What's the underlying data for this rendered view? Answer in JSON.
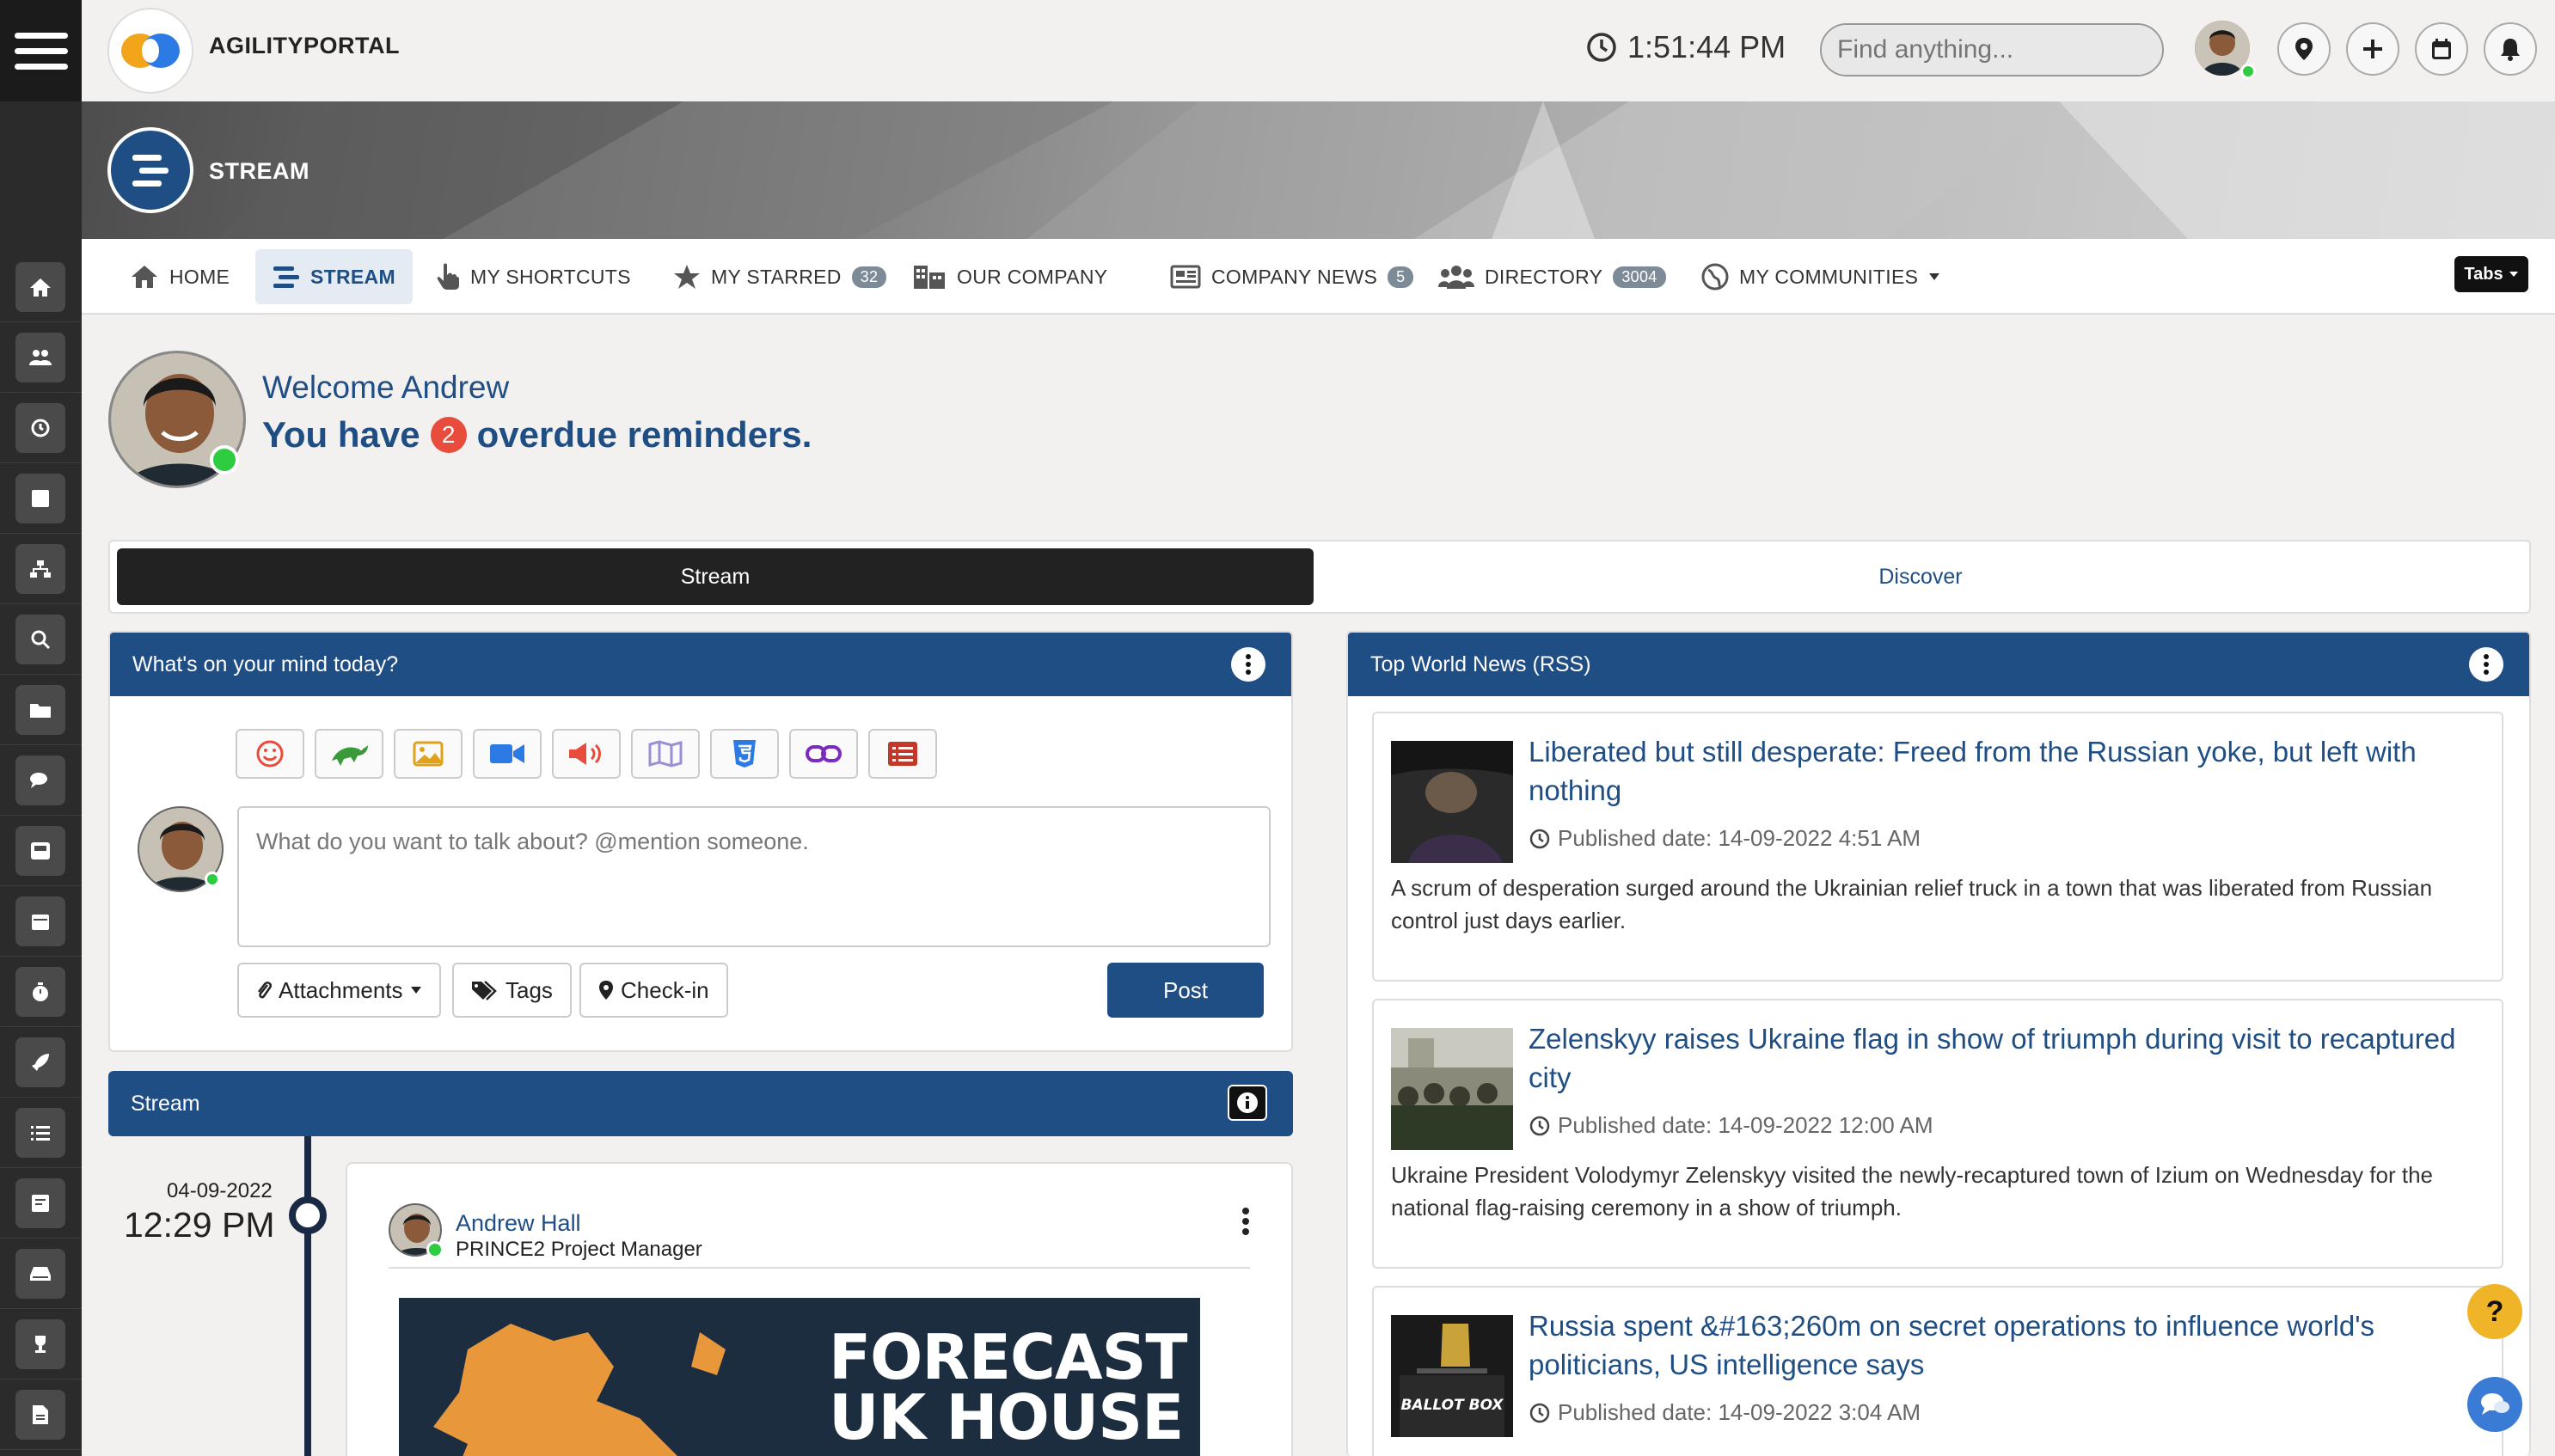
{
  "app": {
    "brand": "AGILITYPORTAL",
    "time": "1:51:44 PM"
  },
  "search": {
    "placeholder": "Find anything..."
  },
  "banner": {
    "title": "STREAM"
  },
  "nav": {
    "tabs": [
      {
        "label": "HOME"
      },
      {
        "label": "STREAM"
      },
      {
        "label": "MY SHORTCUTS"
      },
      {
        "label": "MY STARRED",
        "badge": "32"
      },
      {
        "label": "OUR COMPANY"
      },
      {
        "label": "COMPANY NEWS",
        "badge": "5"
      },
      {
        "label": "DIRECTORY",
        "badge": "3004"
      },
      {
        "label": "MY COMMUNITIES"
      }
    ],
    "tabs_button": "Tabs"
  },
  "welcome": {
    "greeting": "Welcome Andrew",
    "prefix": "You have",
    "count": "2",
    "suffix": "overdue reminders."
  },
  "segment": {
    "stream": "Stream",
    "discover": "Discover"
  },
  "composer": {
    "title": "What's on your mind today?",
    "placeholder": "What do you want to talk about? @mention someone.",
    "attachments": "Attachments",
    "tags": "Tags",
    "checkin": "Check-in",
    "post": "Post"
  },
  "stream": {
    "title": "Stream",
    "date": "04-09-2022",
    "time": "12:29 PM",
    "author": "Andrew Hall",
    "role": "PRINCE2 Project Manager",
    "image_headline": [
      "FORECAST",
      "UK HOUSE"
    ]
  },
  "news": {
    "title": "Top World News (RSS)",
    "items": [
      {
        "title": "Liberated but still desperate: Freed from the Russian yoke, but left with nothing",
        "date": "Published date: 14-09-2022 4:51 AM",
        "summary": "A scrum of desperation surged around the Ukrainian relief truck in a town that was liberated from Russian control just days earlier."
      },
      {
        "title": "Zelenskyy raises Ukraine flag in show of triumph during visit to recaptured city",
        "date": "Published date: 14-09-2022 12:00 AM",
        "summary": "Ukraine President Volodymyr Zelenskyy visited the newly-recaptured town of Izium on Wednesday for the national flag-raising ceremony in a show of triumph."
      },
      {
        "title": "Russia spent &#163;260m on secret operations to influence world's politicians, US intelligence says",
        "date": "Published date: 14-09-2022 3:04 AM",
        "thumb_text": "BALLOT BOX"
      }
    ]
  },
  "help": {
    "label": "?"
  },
  "colors": {
    "primary": "#1f4e84",
    "dark": "#222222",
    "online": "#2ecc40",
    "alert": "#e74c3c"
  }
}
